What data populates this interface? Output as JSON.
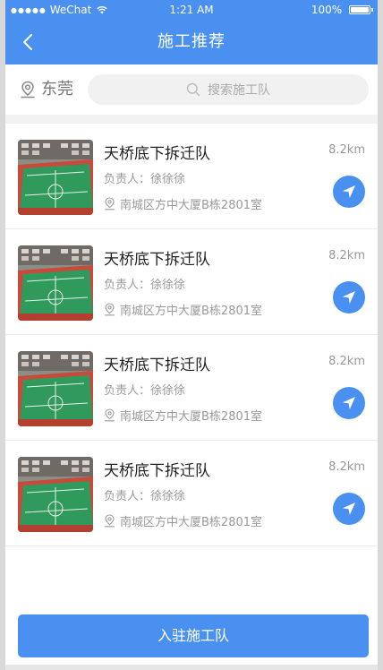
{
  "status_bar": {
    "signal": "●●●●●",
    "carrier": "WeChat",
    "time": "1:21 AM",
    "battery": "100%",
    "battery_level": 1.0
  },
  "nav": {
    "title": "施工推荐",
    "back_icon": "chevron-left-icon"
  },
  "location": {
    "city": "东莞",
    "icon": "location-pin-icon"
  },
  "search": {
    "placeholder": "搜索施工队",
    "icon": "search-icon"
  },
  "teams": [
    {
      "name": "天桥底下拆迁队",
      "manager": "负责人：徐徐徐",
      "address": "南城区方中大厦B栋2801室",
      "distance": "8.2km"
    },
    {
      "name": "天桥底下拆迁队",
      "manager": "负责人：徐徐徐",
      "address": "南城区方中大厦B栋2801室",
      "distance": "8.2km"
    },
    {
      "name": "天桥底下拆迁队",
      "manager": "负责人：徐徐徐",
      "address": "南城区方中大厦B栋2801室",
      "distance": "8.2km"
    },
    {
      "name": "天桥底下拆迁队",
      "manager": "负责人：徐徐徐",
      "address": "南城区方中大厦B栋2801室",
      "distance": "8.2km"
    }
  ],
  "actions": {
    "join_label": "入驻施工队"
  },
  "colors": {
    "primary": "#4a90f0",
    "muted_text": "#999999",
    "title_text": "#222222"
  }
}
